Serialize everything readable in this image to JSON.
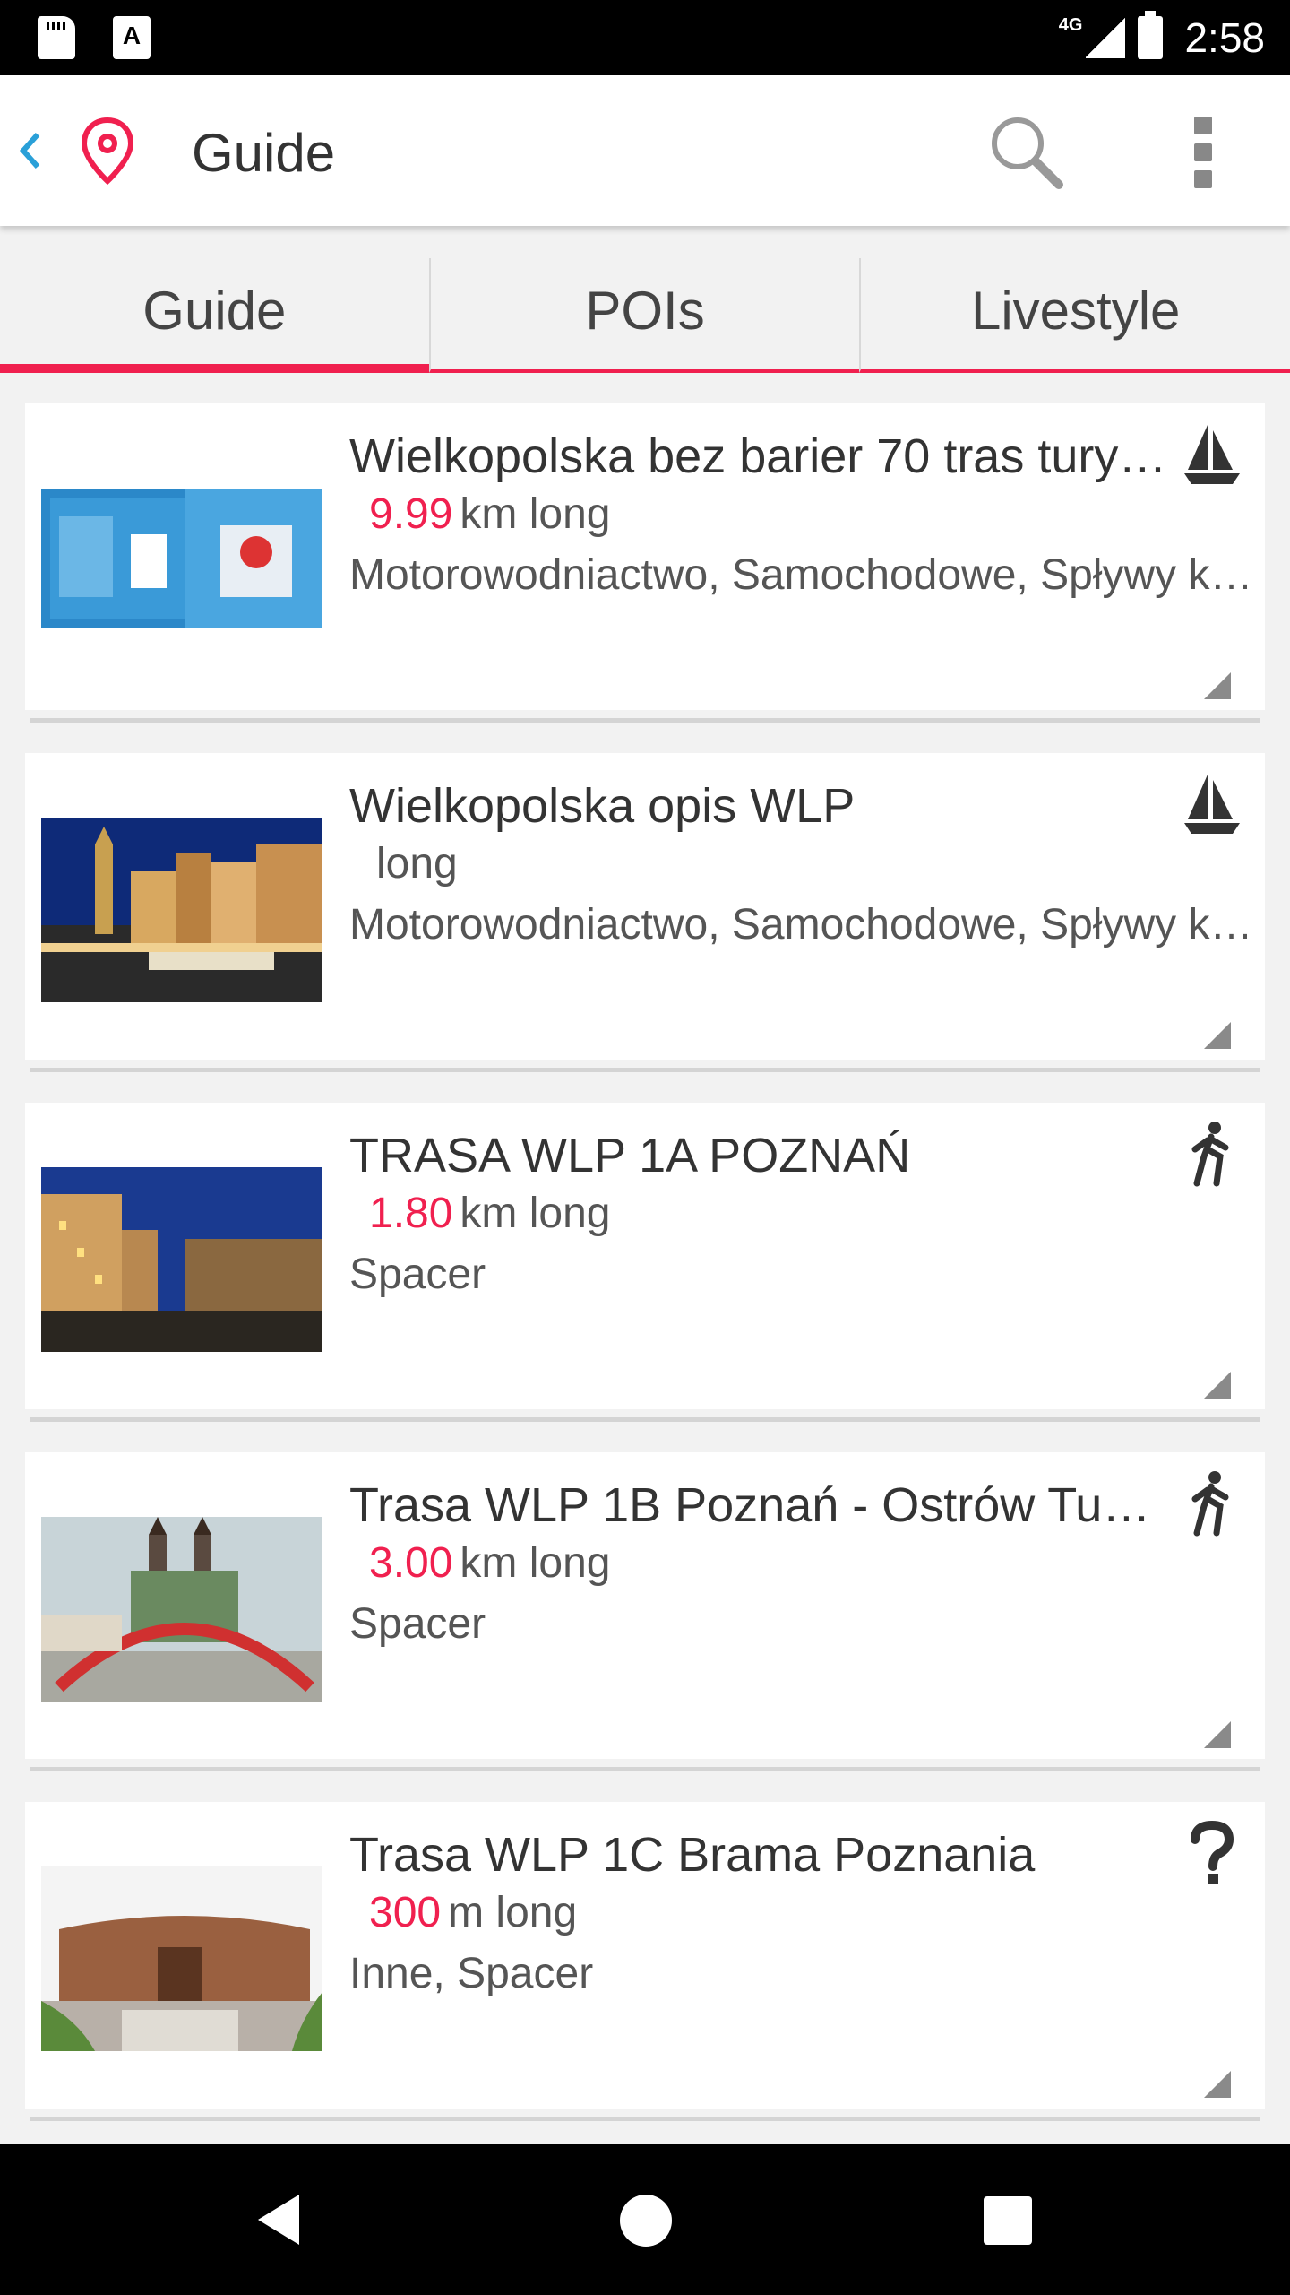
{
  "status_bar": {
    "network": "4G",
    "time": "2:58"
  },
  "app_bar": {
    "title": "Guide",
    "accent_color": "#f0204f"
  },
  "tabs": [
    {
      "label": "Guide",
      "active": true
    },
    {
      "label": "POIs",
      "active": false
    },
    {
      "label": "Livestyle",
      "active": false
    }
  ],
  "cards": [
    {
      "title": "Wielkopolska bez barier 70 tras tury…",
      "distance_value": "9.99",
      "distance_unit": "km long",
      "categories": "Motorowodniactwo, Samochodowe, Spływy k…",
      "type_icon": "sailboat-icon"
    },
    {
      "title": "Wielkopolska opis  WLP",
      "distance_value": "",
      "distance_unit": "long",
      "categories": "Motorowodniactwo, Samochodowe, Spływy k…",
      "type_icon": "sailboat-icon"
    },
    {
      "title": "TRASA WLP 1A POZNAŃ",
      "distance_value": "1.80",
      "distance_unit": "km long",
      "categories": "Spacer",
      "type_icon": "walking-icon"
    },
    {
      "title": " Trasa WLP 1B Poznań - Ostrów Tu…",
      "distance_value": "3.00",
      "distance_unit": "km long",
      "categories": "Spacer",
      "type_icon": "walking-icon"
    },
    {
      "title": "Trasa WLP 1C  Brama Poznania",
      "distance_value": "300",
      "distance_unit": "m long",
      "categories": "Inne, Spacer",
      "type_icon": "question-icon"
    }
  ]
}
